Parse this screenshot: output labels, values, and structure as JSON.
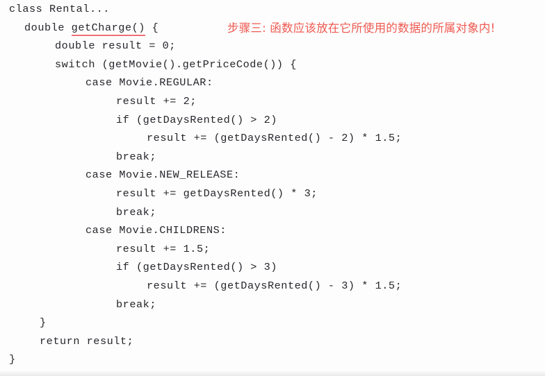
{
  "page": {
    "kind": "scanned-book-code-listing",
    "background_color": "#fdfdfd",
    "code_text_color": "#25262b",
    "annotation_color": "#ef5a52",
    "underline_color": "#ef6f76"
  },
  "code": {
    "language": "Java",
    "lines": [
      {
        "indent": 0,
        "text": "class Rental..."
      },
      {
        "indent": 2,
        "text": "double ",
        "underlined": "getCharge()",
        "tail": " {"
      },
      {
        "indent": 6,
        "text": "double result = 0;"
      },
      {
        "indent": 6,
        "text": "switch (getMovie().getPriceCode()) {"
      },
      {
        "indent": 10,
        "text": "case Movie.REGULAR:"
      },
      {
        "indent": 14,
        "text": "result += 2;"
      },
      {
        "indent": 14,
        "text": "if (getDaysRented() > 2)"
      },
      {
        "indent": 18,
        "text": "result += (getDaysRented() - 2) * 1.5;"
      },
      {
        "indent": 14,
        "text": "break;"
      },
      {
        "indent": 10,
        "text": "case Movie.NEW_RELEASE:"
      },
      {
        "indent": 14,
        "text": "result += getDaysRented() * 3;"
      },
      {
        "indent": 14,
        "text": "break;"
      },
      {
        "indent": 10,
        "text": "case Movie.CHILDRENS:"
      },
      {
        "indent": 14,
        "text": "result += 1.5;"
      },
      {
        "indent": 14,
        "text": "if (getDaysRented() > 3)"
      },
      {
        "indent": 18,
        "text": "result += (getDaysRented() - 3) * 1.5;"
      },
      {
        "indent": 14,
        "text": "break;"
      },
      {
        "indent": 4,
        "text": "}"
      },
      {
        "indent": 4,
        "text": "return result;"
      },
      {
        "indent": 0,
        "text": "}"
      }
    ],
    "line_01": "class Rental...",
    "line_02_head": "double ",
    "line_02_method": "getCharge()",
    "line_02_tail": " {",
    "line_03": "double result = 0;",
    "line_04": "switch (getMovie().getPriceCode()) {",
    "line_05": "case Movie.REGULAR:",
    "line_06": "result += 2;",
    "line_07": "if (getDaysRented() > 2)",
    "line_08": "result += (getDaysRented() - 2) * 1.5;",
    "line_09": "break;",
    "line_10": "case Movie.NEW_RELEASE:",
    "line_11": "result += getDaysRented() * 3;",
    "line_12": "break;",
    "line_13": "case Movie.CHILDRENS:",
    "line_14": "result += 1.5;",
    "line_15": "if (getDaysRented() > 3)",
    "line_16": "result += (getDaysRented() - 3) * 1.5;",
    "line_17": "break;",
    "line_18": "}",
    "line_19": "return result;",
    "line_20": "}"
  },
  "annotation": {
    "label": "步骤三",
    "separator": "：",
    "body": "函数应该放在它所使用的数据的所属对象内！",
    "full_text": "步骤三: 函数应该放在它所使用的数据的所属对象内!"
  }
}
